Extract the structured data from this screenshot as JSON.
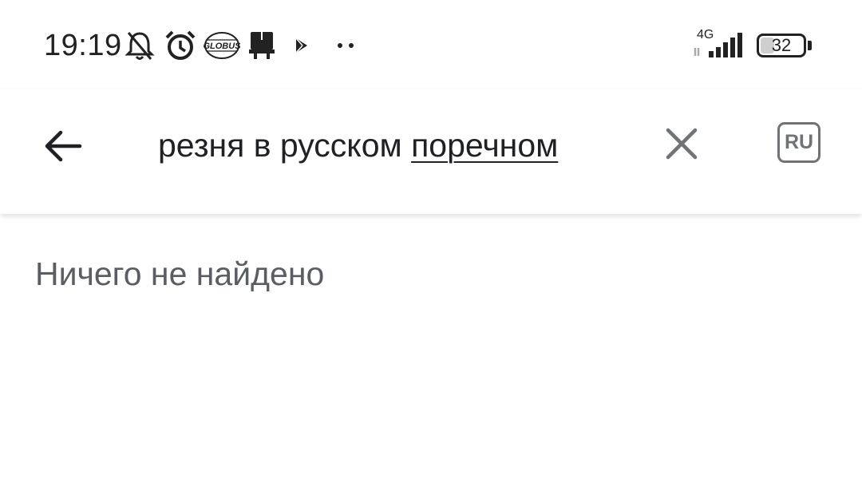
{
  "status_bar": {
    "time": "19:19",
    "icons": [
      "notifications-off-icon",
      "alarm-icon",
      "globus-logo",
      "tv-box-icon",
      "play-store-icon",
      "more-dots-icon"
    ],
    "logo_text": "GLOBUS",
    "network_type": "4G",
    "signal_bars": 5,
    "battery_level": "32",
    "battery_fraction": 0.32
  },
  "search": {
    "back_icon": "arrow-left-icon",
    "query_plain": "резня в русском ",
    "query_underlined": "поречном",
    "clear_icon": "close-icon",
    "language_label": "RU"
  },
  "results": {
    "empty_message": "Ничего не найдено"
  },
  "colors": {
    "background": "#ffffff",
    "text_primary": "#202124",
    "text_secondary": "#5a5e63",
    "icon_gray": "#6f7378"
  }
}
